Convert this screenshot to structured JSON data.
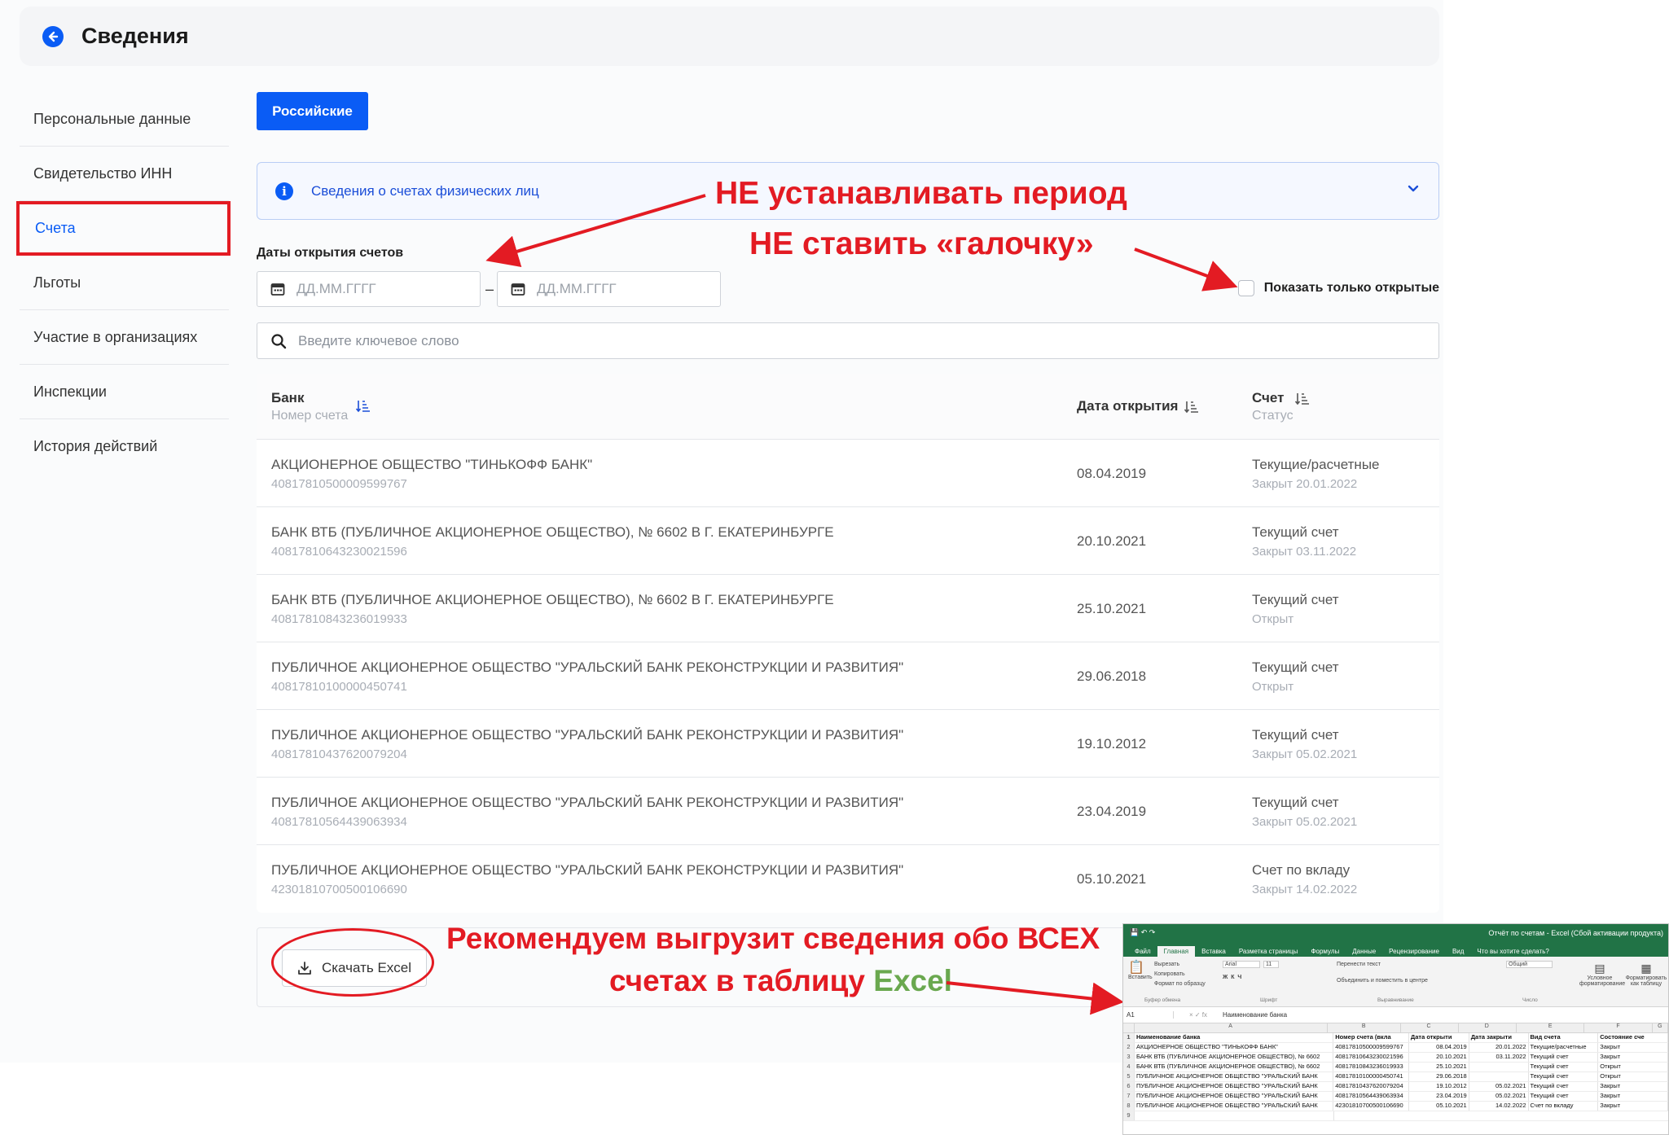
{
  "header": {
    "title": "Сведения"
  },
  "sidebar": {
    "items": [
      {
        "label": "Персональные данные"
      },
      {
        "label": "Свидетельство ИНН"
      },
      {
        "label": "Счета"
      },
      {
        "label": "Льготы"
      },
      {
        "label": "Участие в организациях"
      },
      {
        "label": "Инспекции"
      },
      {
        "label": "История действий"
      }
    ],
    "active_index": 2
  },
  "tabs": {
    "active_label": "Российские"
  },
  "info": {
    "text": "Сведения о счетах физических лиц"
  },
  "filters": {
    "dates_label": "Даты открытия счетов",
    "date_from_placeholder": "ДД.ММ.ГГГГ",
    "date_to_placeholder": "ДД.ММ.ГГГГ",
    "date_dash": "–",
    "only_open_label": "Показать только открытые",
    "only_open_checked": false,
    "search_placeholder": "Введите ключевое слово"
  },
  "table": {
    "headers": {
      "bank": "Банк",
      "bank_sub": "Номер счета",
      "date": "Дата открытия",
      "account": "Счет",
      "account_sub": "Статус"
    },
    "rows": [
      {
        "bank": "АКЦИОНЕРНОЕ ОБЩЕСТВО \"ТИНЬКОФФ БАНК\"",
        "number": "40817810500009599767",
        "date": "08.04.2019",
        "type": "Текущие/расчетные",
        "status": "Закрыт 20.01.2022"
      },
      {
        "bank": "БАНК ВТБ (ПУБЛИЧНОЕ АКЦИОНЕРНОЕ ОБЩЕСТВО), № 6602 В Г. ЕКАТЕРИНБУРГЕ",
        "number": "40817810643230021596",
        "date": "20.10.2021",
        "type": "Текущий счет",
        "status": "Закрыт 03.11.2022"
      },
      {
        "bank": "БАНК ВТБ (ПУБЛИЧНОЕ АКЦИОНЕРНОЕ ОБЩЕСТВО), № 6602 В Г. ЕКАТЕРИНБУРГЕ",
        "number": "40817810843236019933",
        "date": "25.10.2021",
        "type": "Текущий счет",
        "status": "Открыт"
      },
      {
        "bank": "ПУБЛИЧНОЕ АКЦИОНЕРНОЕ ОБЩЕСТВО \"УРАЛЬСКИЙ БАНК РЕКОНСТРУКЦИИ И РАЗВИТИЯ\"",
        "number": "40817810100000450741",
        "date": "29.06.2018",
        "type": "Текущий счет",
        "status": "Открыт"
      },
      {
        "bank": "ПУБЛИЧНОЕ АКЦИОНЕРНОЕ ОБЩЕСТВО \"УРАЛЬСКИЙ БАНК РЕКОНСТРУКЦИИ И РАЗВИТИЯ\"",
        "number": "40817810437620079204",
        "date": "19.10.2012",
        "type": "Текущий счет",
        "status": "Закрыт 05.02.2021"
      },
      {
        "bank": "ПУБЛИЧНОЕ АКЦИОНЕРНОЕ ОБЩЕСТВО \"УРАЛЬСКИЙ БАНК РЕКОНСТРУКЦИИ И РАЗВИТИЯ\"",
        "number": "40817810564439063934",
        "date": "23.04.2019",
        "type": "Текущий счет",
        "status": "Закрыт 05.02.2021"
      },
      {
        "bank": "ПУБЛИЧНОЕ АКЦИОНЕРНОЕ ОБЩЕСТВО \"УРАЛЬСКИЙ БАНК РЕКОНСТРУКЦИИ И РАЗВИТИЯ\"",
        "number": "42301810700500106690",
        "date": "05.10.2021",
        "type": "Счет по вкладу",
        "status": "Закрыт 14.02.2022"
      }
    ]
  },
  "export": {
    "button_label": "Скачать Excel"
  },
  "annotations": {
    "line1": "НЕ устанавливать период",
    "line2": "НЕ ставить «галочку»",
    "line3": "Рекомендуем выгрузит сведения обо ВСЕХ",
    "line4_prefix": "счетах в таблицу ",
    "line4_excel": "Excel",
    "color_red": "#e31b23",
    "color_green": "#6aa84f"
  },
  "excel_preview": {
    "window_title": "Отчёт по счетам - Excel (Сбой активации продукта)",
    "tabs": [
      "Файл",
      "Главная",
      "Вставка",
      "Разметка страницы",
      "Формулы",
      "Данные",
      "Рецензирование",
      "Вид",
      "Что вы хотите сделать?"
    ],
    "active_tab": "Главная",
    "ribbon": {
      "paste": "Вставить",
      "cut": "Вырезать",
      "copy": "Копировать",
      "format_painter": "Формат по образцу",
      "clipboard": "Буфер обмена",
      "font_name": "Arial",
      "font_size": "11",
      "font": "Шрифт",
      "wrap": "Перенести текст",
      "merge": "Объединить и поместить в центре",
      "alignment": "Выравнивание",
      "number_format": "Общий",
      "number": "Число",
      "conditional": "Условное форматирование",
      "format_table": "Форматировать как таблицу"
    },
    "name_box": "A1",
    "formula": "Наименование банка",
    "col_letters": [
      "A",
      "B",
      "C",
      "D",
      "E",
      "F",
      "G"
    ],
    "header_row": [
      "Наименование банка",
      "Номер счета (вкла",
      "Дата открыти",
      "Дата закрыти",
      "Вид счета",
      "Состояние сче"
    ],
    "rows": [
      [
        "АКЦИОНЕРНОЕ ОБЩЕСТВО \"ТИНЬКОФФ БАНК\"",
        "40817810500009599767",
        "08.04.2019",
        "20.01.2022",
        "Текущие/расчетные",
        "Закрыт"
      ],
      [
        "БАНК ВТБ (ПУБЛИЧНОЕ АКЦИОНЕРНОЕ ОБЩЕСТВО), № 6602",
        "40817810643230021596",
        "20.10.2021",
        "03.11.2022",
        "Текущий счет",
        "Закрыт"
      ],
      [
        "БАНК ВТБ (ПУБЛИЧНОЕ АКЦИОНЕРНОЕ ОБЩЕСТВО), № 6602",
        "40817810843236019933",
        "25.10.2021",
        "",
        "Текущий счет",
        "Открыт"
      ],
      [
        "ПУБЛИЧНОЕ АКЦИОНЕРНОЕ ОБЩЕСТВО \"УРАЛЬСКИЙ БАНК",
        "40817810100000450741",
        "29.06.2018",
        "",
        "Текущий счет",
        "Открыт"
      ],
      [
        "ПУБЛИЧНОЕ АКЦИОНЕРНОЕ ОБЩЕСТВО \"УРАЛЬСКИЙ БАНК",
        "40817810437620079204",
        "19.10.2012",
        "05.02.2021",
        "Текущий счет",
        "Закрыт"
      ],
      [
        "ПУБЛИЧНОЕ АКЦИОНЕРНОЕ ОБЩЕСТВО \"УРАЛЬСКИЙ БАНК",
        "40817810564439063934",
        "23.04.2019",
        "05.02.2021",
        "Текущий счет",
        "Закрыт"
      ],
      [
        "ПУБЛИЧНОЕ АКЦИОНЕРНОЕ ОБЩЕСТВО \"УРАЛЬСКИЙ БАНК",
        "42301810700500106690",
        "05.10.2021",
        "14.02.2022",
        "Счет по вкладу",
        "Закрыт"
      ]
    ]
  }
}
